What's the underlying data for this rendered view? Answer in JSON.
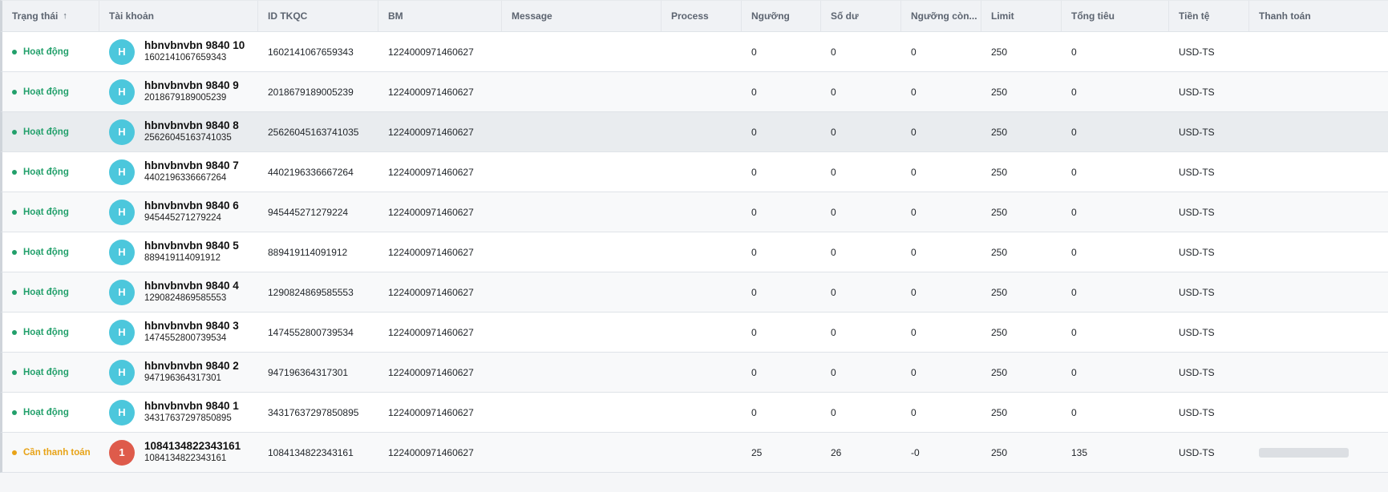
{
  "columns": {
    "status": "Trạng thái",
    "sort_arrow": "↑",
    "account": "Tài khoản",
    "id_tkqc": "ID TKQC",
    "bm": "BM",
    "message": "Message",
    "process": "Process",
    "nguong": "Ngưỡng",
    "so_du": "Số dư",
    "nguong_con": "Ngưỡng còn...",
    "limit": "Limit",
    "tong_tieu": "Tổng tiêu",
    "tien_te": "Tiền tệ",
    "thanh_toan": "Thanh toán"
  },
  "colors": {
    "active": "#22a06b",
    "pending": "#e8a317",
    "avatar_default": "#4cc7dc",
    "avatar_alert": "#de5b4b"
  },
  "rows": [
    {
      "status": "Hoạt động",
      "avatar": "H",
      "name": "hbnvbnvbn 9840 10",
      "sub_id": "1602141067659343",
      "id_tkqc": "1602141067659343",
      "bm": "1224000971460627",
      "message": "",
      "process": "",
      "nguong": "0",
      "so_du": "0",
      "nguong_con": "0",
      "limit": "250",
      "tong_tieu": "0",
      "tien_te": "USD-TS"
    },
    {
      "status": "Hoạt động",
      "avatar": "H",
      "name": "hbnvbnvbn 9840 9",
      "sub_id": "2018679189005239",
      "id_tkqc": "2018679189005239",
      "bm": "1224000971460627",
      "message": "",
      "process": "",
      "nguong": "0",
      "so_du": "0",
      "nguong_con": "0",
      "limit": "250",
      "tong_tieu": "0",
      "tien_te": "USD-TS"
    },
    {
      "status": "Hoạt động",
      "avatar": "H",
      "name": "hbnvbnvbn 9840 8",
      "sub_id": "25626045163741035",
      "id_tkqc": "25626045163741035",
      "bm": "1224000971460627",
      "message": "",
      "process": "",
      "nguong": "0",
      "so_du": "0",
      "nguong_con": "0",
      "limit": "250",
      "tong_tieu": "0",
      "tien_te": "USD-TS"
    },
    {
      "status": "Hoạt động",
      "avatar": "H",
      "name": "hbnvbnvbn 9840 7",
      "sub_id": "4402196336667264",
      "id_tkqc": "4402196336667264",
      "bm": "1224000971460627",
      "message": "",
      "process": "",
      "nguong": "0",
      "so_du": "0",
      "nguong_con": "0",
      "limit": "250",
      "tong_tieu": "0",
      "tien_te": "USD-TS"
    },
    {
      "status": "Hoạt động",
      "avatar": "H",
      "name": "hbnvbnvbn 9840 6",
      "sub_id": "945445271279224",
      "id_tkqc": "945445271279224",
      "bm": "1224000971460627",
      "message": "",
      "process": "",
      "nguong": "0",
      "so_du": "0",
      "nguong_con": "0",
      "limit": "250",
      "tong_tieu": "0",
      "tien_te": "USD-TS"
    },
    {
      "status": "Hoạt động",
      "avatar": "H",
      "name": "hbnvbnvbn 9840 5",
      "sub_id": "889419114091912",
      "id_tkqc": "889419114091912",
      "bm": "1224000971460627",
      "message": "",
      "process": "",
      "nguong": "0",
      "so_du": "0",
      "nguong_con": "0",
      "limit": "250",
      "tong_tieu": "0",
      "tien_te": "USD-TS"
    },
    {
      "status": "Hoạt động",
      "avatar": "H",
      "name": "hbnvbnvbn 9840 4",
      "sub_id": "1290824869585553",
      "id_tkqc": "1290824869585553",
      "bm": "1224000971460627",
      "message": "",
      "process": "",
      "nguong": "0",
      "so_du": "0",
      "nguong_con": "0",
      "limit": "250",
      "tong_tieu": "0",
      "tien_te": "USD-TS"
    },
    {
      "status": "Hoạt động",
      "avatar": "H",
      "name": "hbnvbnvbn 9840 3",
      "sub_id": "1474552800739534",
      "id_tkqc": "1474552800739534",
      "bm": "1224000971460627",
      "message": "",
      "process": "",
      "nguong": "0",
      "so_du": "0",
      "nguong_con": "0",
      "limit": "250",
      "tong_tieu": "0",
      "tien_te": "USD-TS"
    },
    {
      "status": "Hoạt động",
      "avatar": "H",
      "name": "hbnvbnvbn 9840 2",
      "sub_id": "947196364317301",
      "id_tkqc": "947196364317301",
      "bm": "1224000971460627",
      "message": "",
      "process": "",
      "nguong": "0",
      "so_du": "0",
      "nguong_con": "0",
      "limit": "250",
      "tong_tieu": "0",
      "tien_te": "USD-TS"
    },
    {
      "status": "Hoạt động",
      "avatar": "H",
      "name": "hbnvbnvbn 9840 1",
      "sub_id": "34317637297850895",
      "id_tkqc": "34317637297850895",
      "bm": "1224000971460627",
      "message": "",
      "process": "",
      "nguong": "0",
      "so_du": "0",
      "nguong_con": "0",
      "limit": "250",
      "tong_tieu": "0",
      "tien_te": "USD-TS"
    },
    {
      "status": "Cần thanh toán",
      "avatar": "1",
      "name": "1084134822343161",
      "sub_id": "1084134822343161",
      "id_tkqc": "1084134822343161",
      "bm": "1224000971460627",
      "message": "",
      "process": "",
      "nguong": "25",
      "so_du": "26",
      "nguong_con": "-0",
      "limit": "250",
      "tong_tieu": "135",
      "tien_te": "USD-TS"
    }
  ]
}
